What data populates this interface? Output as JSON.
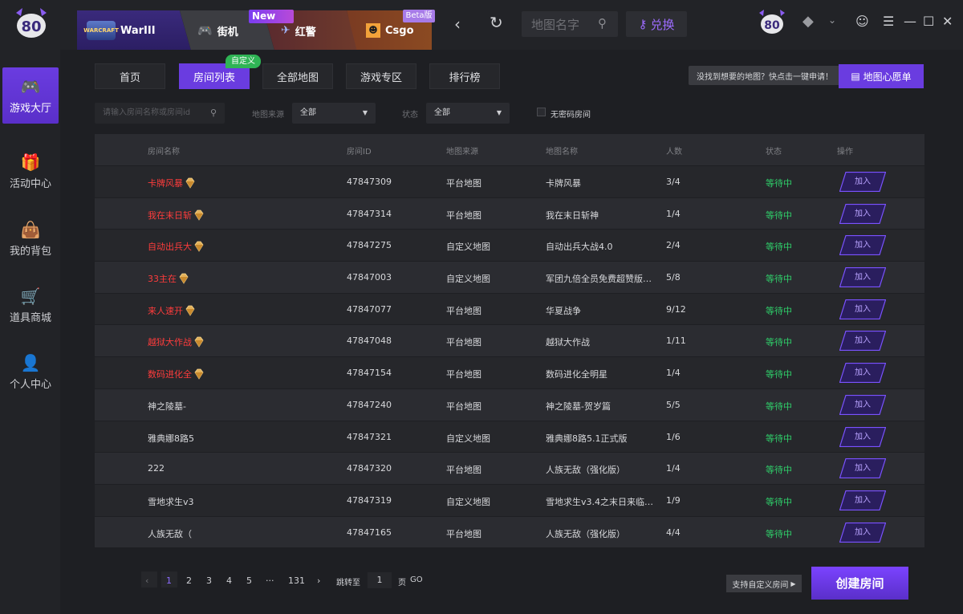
{
  "top": {
    "tabs": [
      {
        "label": "WarIII",
        "badge": "WARCRAFT"
      },
      {
        "label": "街机"
      },
      {
        "label": "红警"
      },
      {
        "label": "Csgo"
      }
    ],
    "new_badge": "New",
    "beta_badge": "Beta版",
    "search_placeholder": "地图名字",
    "redeem_label": "兑换"
  },
  "sidebar": {
    "items": [
      {
        "label": "游戏大厅",
        "icon": "gamepad-icon"
      },
      {
        "label": "活动中心",
        "icon": "gift-icon"
      },
      {
        "label": "我的背包",
        "icon": "bag-icon"
      },
      {
        "label": "道具商城",
        "icon": "cart-icon"
      },
      {
        "label": "个人中心",
        "icon": "user-icon"
      }
    ]
  },
  "subtabs": [
    "首页",
    "房间列表",
    "全部地图",
    "游戏专区",
    "排行榜"
  ],
  "custom_tag": "自定义",
  "wish_hint": "没找到想要的地图？快点击一键申请！",
  "wish_button": "地图心愿单",
  "filters": {
    "room_placeholder": "请输入房间名称或房间id",
    "source_label": "地图来源",
    "source_value": "全部",
    "status_label": "状态",
    "status_value": "全部",
    "nopwd_label": "无密码房间"
  },
  "table": {
    "headers": [
      "房间名称",
      "房间ID",
      "地图来源",
      "地图名称",
      "人数",
      "状态",
      "操作"
    ],
    "join_label": "加入",
    "rows": [
      {
        "name": "卡牌风暴",
        "id": "47847309",
        "source": "平台地图",
        "map": "卡牌风暴",
        "count": "3/4",
        "status": "等待中",
        "vip": true
      },
      {
        "name": "我在末日斩",
        "id": "47847314",
        "source": "平台地图",
        "map": "我在末日斩神",
        "count": "1/4",
        "status": "等待中",
        "vip": true
      },
      {
        "name": "自动出兵大",
        "id": "47847275",
        "source": "自定义地图",
        "map": "自动出兵大战4.0",
        "count": "2/4",
        "status": "等待中",
        "vip": true
      },
      {
        "name": "33主在",
        "id": "47847003",
        "source": "自定义地图",
        "map": "军团九倍全员免费超赞版…",
        "count": "5/8",
        "status": "等待中",
        "vip": true
      },
      {
        "name": "来人速开",
        "id": "47847077",
        "source": "平台地图",
        "map": "华夏战争",
        "count": "9/12",
        "status": "等待中",
        "vip": true
      },
      {
        "name": "越狱大作战",
        "id": "47847048",
        "source": "平台地图",
        "map": "越狱大作战",
        "count": "1/11",
        "status": "等待中",
        "vip": true
      },
      {
        "name": "数码进化全",
        "id": "47847154",
        "source": "平台地图",
        "map": "数码进化全明星",
        "count": "1/4",
        "status": "等待中",
        "vip": true
      },
      {
        "name": "神之陵墓-",
        "id": "47847240",
        "source": "平台地图",
        "map": "神之陵墓-贺岁篇",
        "count": "5/5",
        "status": "等待中",
        "vip": false
      },
      {
        "name": "雅典娜8路5",
        "id": "47847321",
        "source": "自定义地图",
        "map": "雅典娜8路5.1正式版",
        "count": "1/6",
        "status": "等待中",
        "vip": false
      },
      {
        "name": "222",
        "id": "47847320",
        "source": "平台地图",
        "map": "人族无敌（强化版）",
        "count": "1/4",
        "status": "等待中",
        "vip": false
      },
      {
        "name": "雪地求生v3",
        "id": "47847319",
        "source": "自定义地图",
        "map": "雪地求生v3.4之末日来临…",
        "count": "1/9",
        "status": "等待中",
        "vip": false
      },
      {
        "name": "人族无敌（",
        "id": "47847165",
        "source": "平台地图",
        "map": "人族无敌（强化版）",
        "count": "4/4",
        "status": "等待中",
        "vip": false
      }
    ]
  },
  "pagination": {
    "pages": [
      "1",
      "2",
      "3",
      "4",
      "5",
      "···",
      "131"
    ],
    "current": "1",
    "goto_label": "跳转至",
    "goto_value": "1",
    "page_unit": "页",
    "go": "GO"
  },
  "create": {
    "hint": "支持自定义房间",
    "button": "创建房间"
  },
  "colors": {
    "accent": "#6a3ce0",
    "status_green": "#2fcf6a",
    "vip_red": "#ff3c3c"
  }
}
